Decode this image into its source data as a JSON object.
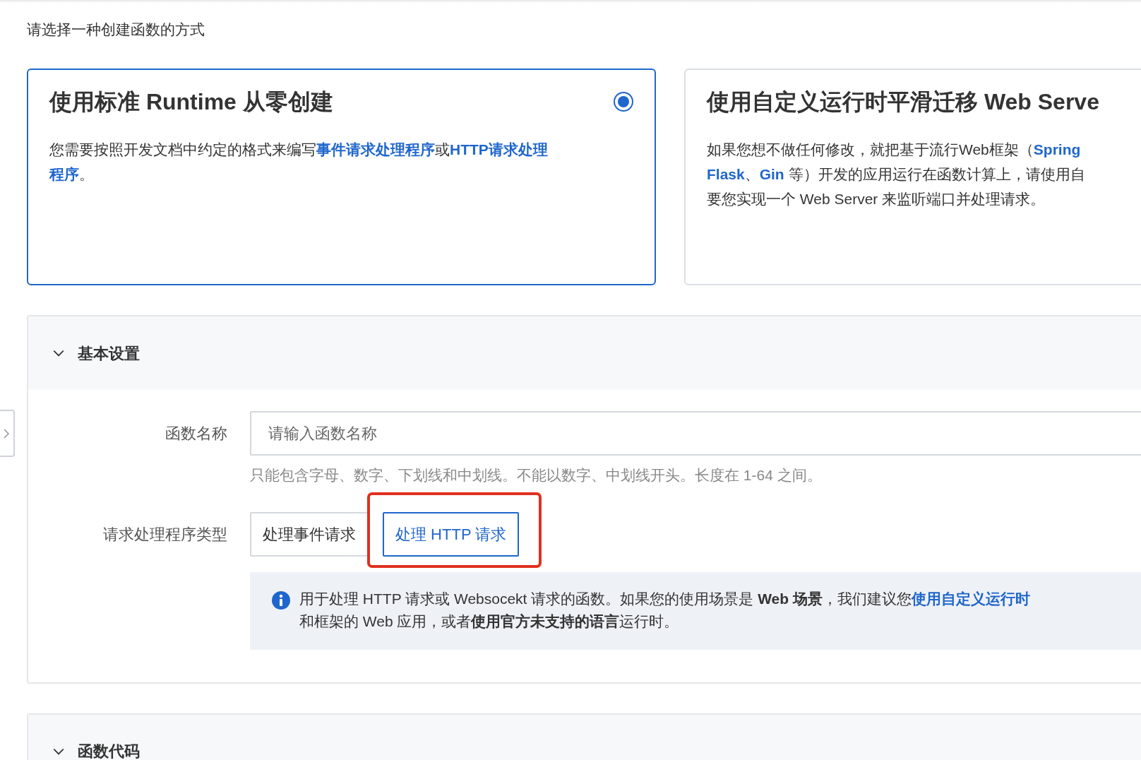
{
  "heading": "请选择一种创建函数的方式",
  "cards": [
    {
      "title": "使用标准 Runtime 从零创建",
      "selected": true,
      "radio": {
        "checked": true
      },
      "lines": [
        [
          {
            "kind": "plain",
            "text": "您需要按照开发文档中约定的格式来编写"
          },
          {
            "kind": "link",
            "text": "事件请求处理程序"
          },
          {
            "kind": "plain",
            "text": "或"
          },
          {
            "kind": "link",
            "text": "HTTP请求处理"
          }
        ],
        [
          {
            "kind": "link",
            "text": "程序"
          },
          {
            "kind": "plain",
            "text": "。"
          }
        ]
      ]
    },
    {
      "title": "使用自定义运行时平滑迁移 Web Serve",
      "selected": false,
      "lines": [
        [
          {
            "kind": "plain",
            "text": "如果您想不做任何修改，就把基于流行Web框架（"
          },
          {
            "kind": "link",
            "text": "Spring"
          }
        ],
        [
          {
            "kind": "link",
            "text": "Flask"
          },
          {
            "kind": "plain",
            "text": "、"
          },
          {
            "kind": "link",
            "text": "Gin"
          },
          {
            "kind": "plain",
            "text": " 等）开发的应用运行在函数计算上，请使用自"
          }
        ],
        [
          {
            "kind": "plain",
            "text": "要您实现一个 Web Server 来监听端口并处理请求。"
          }
        ]
      ]
    }
  ],
  "sections": [
    {
      "title": "基本设置",
      "expanded": true,
      "form": {
        "name_field": {
          "label": "函数名称",
          "placeholder": "请输入函数名称",
          "help": "只能包含字母、数字、下划线和中划线。不能以数字、中划线开头。长度在 1-64 之间。"
        },
        "handler_type": {
          "label": "请求处理程序类型",
          "options": [
            {
              "label": "处理事件请求",
              "selected": false,
              "highlighted": false
            },
            {
              "label": "处理 HTTP 请求",
              "selected": true,
              "highlighted": true
            }
          ]
        },
        "info_lines": [
          [
            {
              "kind": "plain",
              "text": "用于处理 HTTP 请求或 Websocekt 请求的函数。如果您的使用场景是 "
            },
            {
              "kind": "bold",
              "text": "Web 场景"
            },
            {
              "kind": "plain",
              "text": "，我们建议您"
            },
            {
              "kind": "link",
              "text": "使用自定义运行时"
            }
          ],
          [
            {
              "kind": "plain",
              "text": "和框架的 Web 应用，或者"
            },
            {
              "kind": "bold",
              "text": "使用官方未支持的语言"
            },
            {
              "kind": "plain",
              "text": "运行时。"
            }
          ]
        ]
      }
    },
    {
      "title": "函数代码",
      "expanded": true
    }
  ]
}
